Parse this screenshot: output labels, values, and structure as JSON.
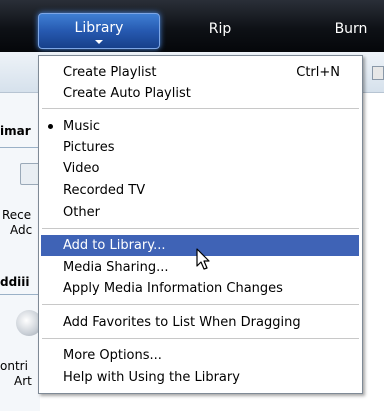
{
  "tabs": {
    "library": "Library",
    "rip": "Rip",
    "burn": "Burn"
  },
  "background": {
    "header1": "imar",
    "recent1": "Rece",
    "recent2": "Adc",
    "header2": "ddiii",
    "contrib1": "ontri",
    "contrib2": "Art"
  },
  "menu": {
    "create_playlist": "Create Playlist",
    "create_playlist_shortcut": "Ctrl+N",
    "create_auto_playlist": "Create Auto Playlist",
    "music": "Music",
    "pictures": "Pictures",
    "video": "Video",
    "recorded_tv": "Recorded TV",
    "other": "Other",
    "add_to_library": "Add to Library...",
    "media_sharing": "Media Sharing...",
    "apply_media_info": "Apply Media Information Changes",
    "add_favorites": "Add Favorites to List When Dragging",
    "more_options": "More Options...",
    "help_library": "Help with Using the Library"
  }
}
